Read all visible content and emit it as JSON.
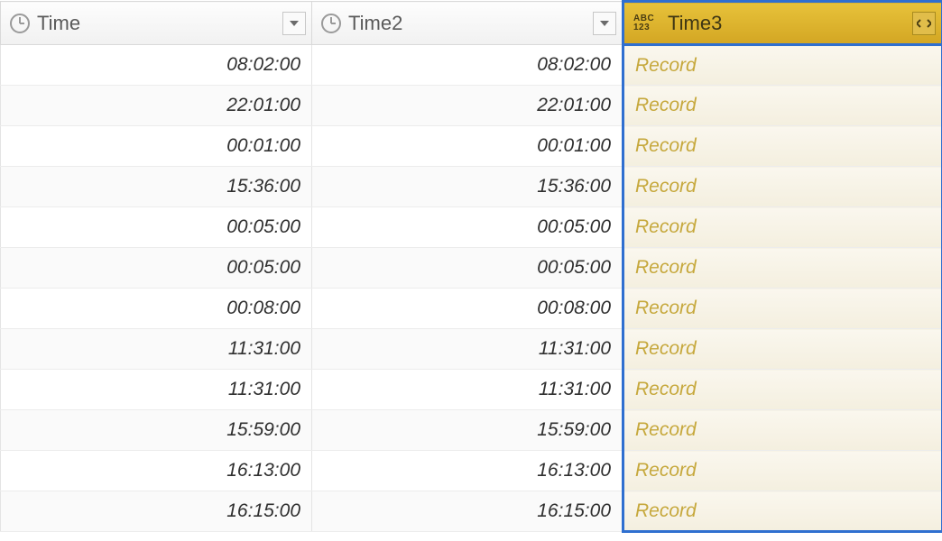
{
  "columns": {
    "time": {
      "label": "Time",
      "type_icon": "clock"
    },
    "time2": {
      "label": "Time2",
      "type_icon": "clock"
    },
    "time3": {
      "label": "Time3",
      "type_icon": "anytype",
      "anytype_top": "ABC",
      "anytype_bottom": "123",
      "selected": true
    }
  },
  "record_link_label": "Record",
  "rows": [
    {
      "time": "08:02:00",
      "time2": "08:02:00",
      "time3": "Record"
    },
    {
      "time": "22:01:00",
      "time2": "22:01:00",
      "time3": "Record"
    },
    {
      "time": "00:01:00",
      "time2": "00:01:00",
      "time3": "Record"
    },
    {
      "time": "15:36:00",
      "time2": "15:36:00",
      "time3": "Record"
    },
    {
      "time": "00:05:00",
      "time2": "00:05:00",
      "time3": "Record"
    },
    {
      "time": "00:05:00",
      "time2": "00:05:00",
      "time3": "Record"
    },
    {
      "time": "00:08:00",
      "time2": "00:08:00",
      "time3": "Record"
    },
    {
      "time": "11:31:00",
      "time2": "11:31:00",
      "time3": "Record"
    },
    {
      "time": "11:31:00",
      "time2": "11:31:00",
      "time3": "Record"
    },
    {
      "time": "15:59:00",
      "time2": "15:59:00",
      "time3": "Record"
    },
    {
      "time": "16:13:00",
      "time2": "16:13:00",
      "time3": "Record"
    },
    {
      "time": "16:15:00",
      "time2": "16:15:00",
      "time3": "Record"
    }
  ]
}
